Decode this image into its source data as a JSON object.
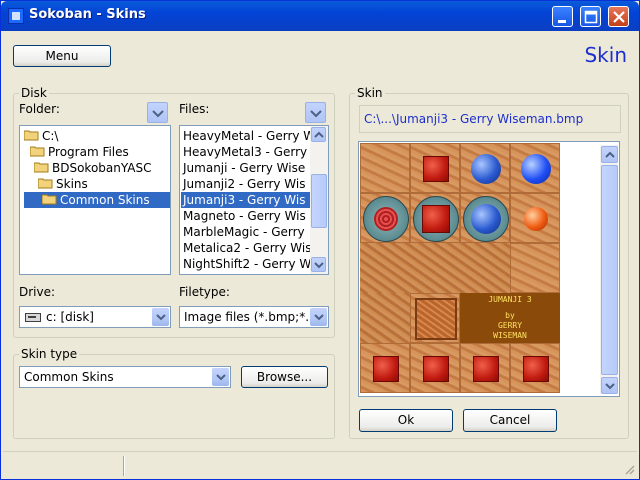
{
  "window": {
    "title": "Sokoban - Skins"
  },
  "toolbar": {
    "menu_label": "Menu",
    "headline": "Skin"
  },
  "disk": {
    "group_label": "Disk",
    "folder_label": "Folder:",
    "files_label": "Files:",
    "drive_label": "Drive:",
    "filetype_label": "Filetype:",
    "folders": [
      "C:\\",
      "Program Files",
      "BDSokobanYASC",
      "Skins",
      "Common Skins"
    ],
    "files": [
      "HeavyMetal - Gerry W",
      "HeavyMetal3 - Gerry W",
      "Jumanji - Gerry Wise",
      "Jumanji2 - Gerry Wis",
      "Jumanji3 - Gerry Wis",
      "Magneto - Gerry Wis",
      "MarbleMagic - Gerry",
      "Metalica2 - Gerry Wis",
      "NightShift2 - Gerry W"
    ],
    "drive_value": "c: [disk]",
    "filetype_value": "Image files  (*.bmp;*."
  },
  "skintype": {
    "group_label": "Skin type",
    "value": "Common Skins",
    "browse_label": "Browse..."
  },
  "skin": {
    "group_label": "Skin",
    "path": "C:\\...\\Jumanji3 - Gerry Wiseman.bmp",
    "title_line1": "JUMANJI 3",
    "title_line2": "by",
    "title_line3": "GERRY",
    "title_line4": "WISEMAN",
    "ok_label": "Ok",
    "cancel_label": "Cancel"
  },
  "colors": {
    "accent": "#1c2fce",
    "selection": "#316ac5",
    "titlebar": "#0343d6"
  }
}
